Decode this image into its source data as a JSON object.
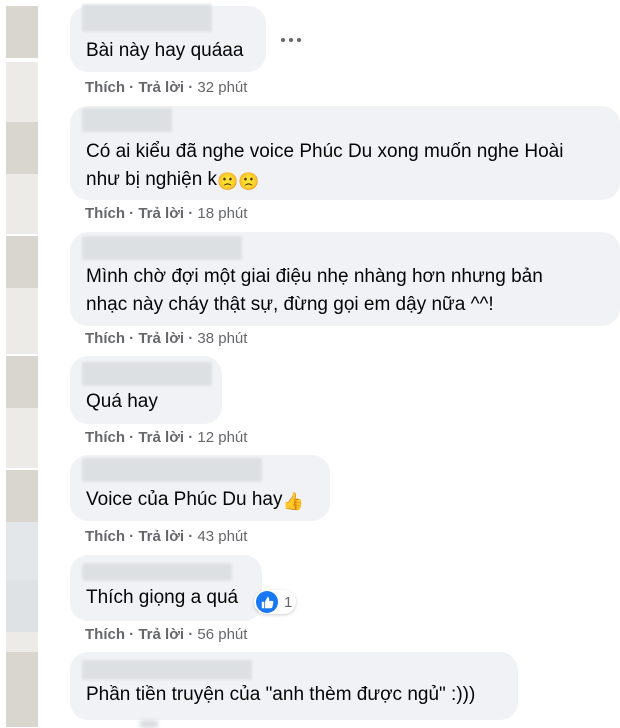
{
  "actions": {
    "like": "Thích",
    "reply": "Trả lời",
    "dot": "·"
  },
  "comments": [
    {
      "text": "Bài này hay quáaa",
      "time": "32 phút"
    },
    {
      "text_line1": "Có ai kiểu đã nghe voice Phúc Du xong muốn nghe Hoài",
      "text_line2": "như bị nghiện k",
      "emoji": "🙁",
      "time": "18 phút"
    },
    {
      "text_line1": "Mình chờ đợi một giai điệu nhẹ nhàng hơn nhưng bản",
      "text_line2": "nhạc này cháy thật sự, đừng gọi em dậy nữa ^^!",
      "time": "38 phút"
    },
    {
      "text": "Quá hay",
      "time": "12 phút"
    },
    {
      "text": "Voice của Phúc Du hay",
      "emoji": "👍",
      "time": "43 phút"
    },
    {
      "text": "Thích giọng a quá",
      "reaction_count": "1",
      "time": "56 phút"
    },
    {
      "text": "Phần tiền truyện của \"anh thèm được ngủ\" :)))"
    }
  ],
  "icons": {
    "more": "more-options-icon",
    "like_reaction": "like-reaction-icon"
  },
  "colors": {
    "bubble": "#f0f2f5",
    "meta": "#65676b",
    "like_blue": "#1877f2"
  }
}
